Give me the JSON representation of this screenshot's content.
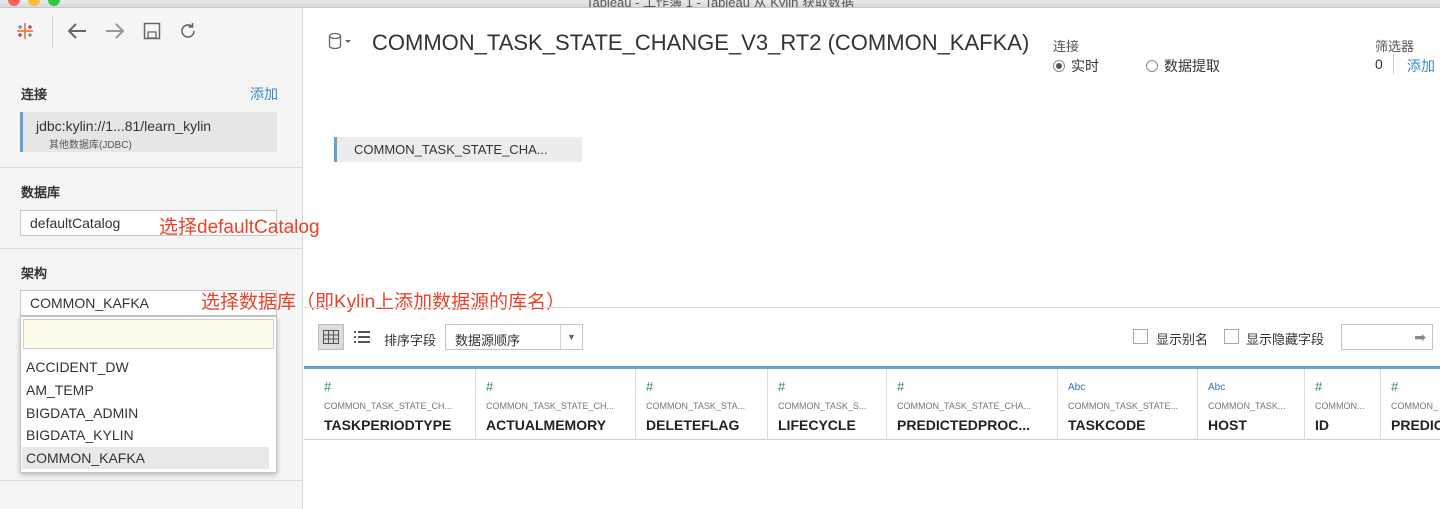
{
  "window": {
    "title": "Tableau - 工作簿 1 - Tableau 从 Kylin 获取数据"
  },
  "toolbar": {
    "icons": [
      "tableau-logo-icon",
      "back-arrow-icon",
      "forward-arrow-icon",
      "save-icon",
      "refresh-icon"
    ]
  },
  "left": {
    "connections_label": "连接",
    "add_label": "添加",
    "connection": {
      "url": "jdbc:kylin://1...81/learn_kylin",
      "type": "其他数据库(JDBC)"
    },
    "database_label": "数据库",
    "database_value": "defaultCatalog",
    "database_annotation": "选择defaultCatalog",
    "schema_label": "架构",
    "schema_value": "COMMON_KAFKA",
    "schema_annotation": "选择数据库（即Kylin上添加数据源的库名）",
    "schema_options": [
      "ACCIDENT_DW",
      "AM_TEMP",
      "BIGDATA_ADMIN",
      "BIGDATA_KYLIN",
      "COMMON_KAFKA"
    ],
    "schema_selected": "COMMON_KAFKA"
  },
  "main": {
    "datasource_title": "COMMON_TASK_STATE_CHANGE_V3_RT2 (COMMON_KAFKA)",
    "connection_head": "连接",
    "live_label": "实时",
    "extract_label": "数据提取",
    "connection_mode": "实时",
    "filter_head": "筛选器",
    "filter_count": "0",
    "filter_add": "添加",
    "table_chip": "COMMON_TASK_STATE_CHA...",
    "sort_label": "排序字段",
    "sort_value": "数据源顺序",
    "show_alias": "显示别名",
    "show_hidden": "显示隐藏字段"
  },
  "columns": [
    {
      "type": "#",
      "table": "COMMON_TASK_STATE_CH...",
      "name": "TASKPERIODTYPE"
    },
    {
      "type": "#",
      "table": "COMMON_TASK_STATE_CH...",
      "name": "ACTUALMEMORY"
    },
    {
      "type": "#",
      "table": "COMMON_TASK_STA...",
      "name": "DELETEFLAG"
    },
    {
      "type": "#",
      "table": "COMMON_TASK_S...",
      "name": "LIFECYCLE"
    },
    {
      "type": "#",
      "table": "COMMON_TASK_STATE_CHA...",
      "name": "PREDICTEDPROC..."
    },
    {
      "type": "Abc",
      "table": "COMMON_TASK_STATE...",
      "name": "TASKCODE"
    },
    {
      "type": "Abc",
      "table": "COMMON_TASK...",
      "name": "HOST"
    },
    {
      "type": "#",
      "table": "COMMON...",
      "name": "ID"
    },
    {
      "type": "#",
      "table": "COMMON_",
      "name": "PREDIC"
    }
  ],
  "colors": {
    "accent": "#6a9ecb",
    "link": "#3b8cc4",
    "annotation": "#e8412c",
    "number_type": "#2f8a5d"
  }
}
